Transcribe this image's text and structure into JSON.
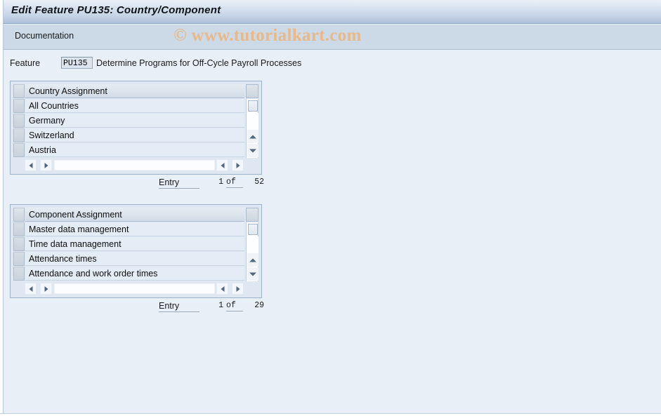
{
  "window": {
    "title": "Edit Feature PU135: Country/Component"
  },
  "toolbar": {
    "documentation_label": "Documentation"
  },
  "watermark": {
    "text": "© www.tutorialkart.com",
    "color": "#e8b98a"
  },
  "feature": {
    "label": "Feature",
    "value": "PU135",
    "placeholder": "",
    "description": "Determine Programs for Off-Cycle Payroll Processes"
  },
  "tables": [
    {
      "id": "country-assignment",
      "header": "Country Assignment",
      "rows": [
        "All Countries",
        "Germany",
        "Switzerland",
        "Austria"
      ],
      "entry": {
        "label": "Entry",
        "current": "1",
        "of": "of",
        "total": "52"
      }
    },
    {
      "id": "component-assignment",
      "header": "Component Assignment",
      "rows": [
        "Master data management",
        "Time data management",
        "Attendance times",
        "Attendance and work order times"
      ],
      "entry": {
        "label": "Entry",
        "current": "1",
        "of": "of",
        "total": "29"
      }
    }
  ],
  "icons": {
    "scroll_up": "scroll-up-arrow-icon",
    "scroll_down": "scroll-down-arrow-icon",
    "scroll_left": "scroll-left-arrow-icon",
    "scroll_right": "scroll-right-arrow-icon"
  },
  "colors": {
    "background": "#e9eff7",
    "titlebar_top": "#eaf0f8",
    "titlebar_bottom": "#adc0da",
    "toolbar": "#ccd9e7",
    "grid_cell": "#e4ecf5",
    "grid_header": "#d2dce7"
  }
}
